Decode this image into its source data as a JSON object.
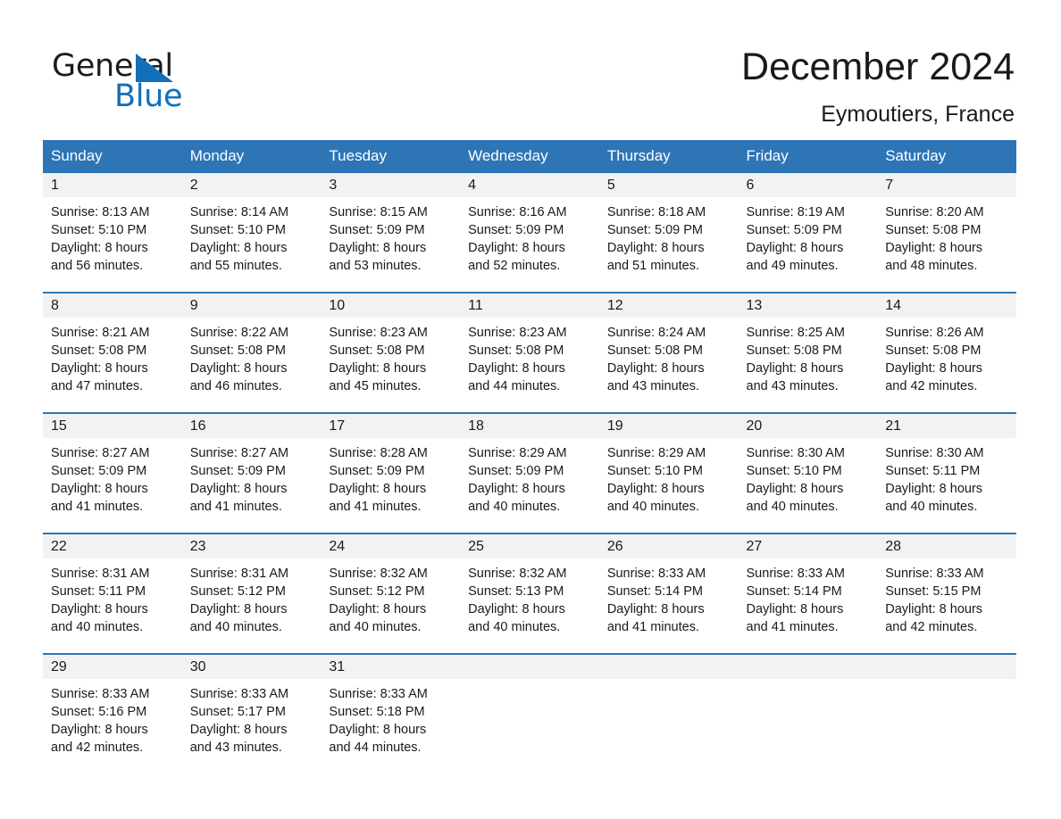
{
  "brand": {
    "name_part1": "General",
    "name_part2": "Blue",
    "triangle_color": "#1270ba",
    "logo_icon": "triangle-icon"
  },
  "header": {
    "title": "December 2024",
    "subtitle": "Eymoutiers, France"
  },
  "colors": {
    "header_blue": "#2e75b6",
    "daynum_gray": "#f2f2f2",
    "text": "#1a1a1a",
    "brand_blue": "#1270ba"
  },
  "calendar": {
    "weekday_headers": [
      "Sunday",
      "Monday",
      "Tuesday",
      "Wednesday",
      "Thursday",
      "Friday",
      "Saturday"
    ],
    "weeks": [
      [
        {
          "day": "1",
          "sunrise": "Sunrise: 8:13 AM",
          "sunset": "Sunset: 5:10 PM",
          "daylight_line1": "Daylight: 8 hours",
          "daylight_line2": "and 56 minutes."
        },
        {
          "day": "2",
          "sunrise": "Sunrise: 8:14 AM",
          "sunset": "Sunset: 5:10 PM",
          "daylight_line1": "Daylight: 8 hours",
          "daylight_line2": "and 55 minutes."
        },
        {
          "day": "3",
          "sunrise": "Sunrise: 8:15 AM",
          "sunset": "Sunset: 5:09 PM",
          "daylight_line1": "Daylight: 8 hours",
          "daylight_line2": "and 53 minutes."
        },
        {
          "day": "4",
          "sunrise": "Sunrise: 8:16 AM",
          "sunset": "Sunset: 5:09 PM",
          "daylight_line1": "Daylight: 8 hours",
          "daylight_line2": "and 52 minutes."
        },
        {
          "day": "5",
          "sunrise": "Sunrise: 8:18 AM",
          "sunset": "Sunset: 5:09 PM",
          "daylight_line1": "Daylight: 8 hours",
          "daylight_line2": "and 51 minutes."
        },
        {
          "day": "6",
          "sunrise": "Sunrise: 8:19 AM",
          "sunset": "Sunset: 5:09 PM",
          "daylight_line1": "Daylight: 8 hours",
          "daylight_line2": "and 49 minutes."
        },
        {
          "day": "7",
          "sunrise": "Sunrise: 8:20 AM",
          "sunset": "Sunset: 5:08 PM",
          "daylight_line1": "Daylight: 8 hours",
          "daylight_line2": "and 48 minutes."
        }
      ],
      [
        {
          "day": "8",
          "sunrise": "Sunrise: 8:21 AM",
          "sunset": "Sunset: 5:08 PM",
          "daylight_line1": "Daylight: 8 hours",
          "daylight_line2": "and 47 minutes."
        },
        {
          "day": "9",
          "sunrise": "Sunrise: 8:22 AM",
          "sunset": "Sunset: 5:08 PM",
          "daylight_line1": "Daylight: 8 hours",
          "daylight_line2": "and 46 minutes."
        },
        {
          "day": "10",
          "sunrise": "Sunrise: 8:23 AM",
          "sunset": "Sunset: 5:08 PM",
          "daylight_line1": "Daylight: 8 hours",
          "daylight_line2": "and 45 minutes."
        },
        {
          "day": "11",
          "sunrise": "Sunrise: 8:23 AM",
          "sunset": "Sunset: 5:08 PM",
          "daylight_line1": "Daylight: 8 hours",
          "daylight_line2": "and 44 minutes."
        },
        {
          "day": "12",
          "sunrise": "Sunrise: 8:24 AM",
          "sunset": "Sunset: 5:08 PM",
          "daylight_line1": "Daylight: 8 hours",
          "daylight_line2": "and 43 minutes."
        },
        {
          "day": "13",
          "sunrise": "Sunrise: 8:25 AM",
          "sunset": "Sunset: 5:08 PM",
          "daylight_line1": "Daylight: 8 hours",
          "daylight_line2": "and 43 minutes."
        },
        {
          "day": "14",
          "sunrise": "Sunrise: 8:26 AM",
          "sunset": "Sunset: 5:08 PM",
          "daylight_line1": "Daylight: 8 hours",
          "daylight_line2": "and 42 minutes."
        }
      ],
      [
        {
          "day": "15",
          "sunrise": "Sunrise: 8:27 AM",
          "sunset": "Sunset: 5:09 PM",
          "daylight_line1": "Daylight: 8 hours",
          "daylight_line2": "and 41 minutes."
        },
        {
          "day": "16",
          "sunrise": "Sunrise: 8:27 AM",
          "sunset": "Sunset: 5:09 PM",
          "daylight_line1": "Daylight: 8 hours",
          "daylight_line2": "and 41 minutes."
        },
        {
          "day": "17",
          "sunrise": "Sunrise: 8:28 AM",
          "sunset": "Sunset: 5:09 PM",
          "daylight_line1": "Daylight: 8 hours",
          "daylight_line2": "and 41 minutes."
        },
        {
          "day": "18",
          "sunrise": "Sunrise: 8:29 AM",
          "sunset": "Sunset: 5:09 PM",
          "daylight_line1": "Daylight: 8 hours",
          "daylight_line2": "and 40 minutes."
        },
        {
          "day": "19",
          "sunrise": "Sunrise: 8:29 AM",
          "sunset": "Sunset: 5:10 PM",
          "daylight_line1": "Daylight: 8 hours",
          "daylight_line2": "and 40 minutes."
        },
        {
          "day": "20",
          "sunrise": "Sunrise: 8:30 AM",
          "sunset": "Sunset: 5:10 PM",
          "daylight_line1": "Daylight: 8 hours",
          "daylight_line2": "and 40 minutes."
        },
        {
          "day": "21",
          "sunrise": "Sunrise: 8:30 AM",
          "sunset": "Sunset: 5:11 PM",
          "daylight_line1": "Daylight: 8 hours",
          "daylight_line2": "and 40 minutes."
        }
      ],
      [
        {
          "day": "22",
          "sunrise": "Sunrise: 8:31 AM",
          "sunset": "Sunset: 5:11 PM",
          "daylight_line1": "Daylight: 8 hours",
          "daylight_line2": "and 40 minutes."
        },
        {
          "day": "23",
          "sunrise": "Sunrise: 8:31 AM",
          "sunset": "Sunset: 5:12 PM",
          "daylight_line1": "Daylight: 8 hours",
          "daylight_line2": "and 40 minutes."
        },
        {
          "day": "24",
          "sunrise": "Sunrise: 8:32 AM",
          "sunset": "Sunset: 5:12 PM",
          "daylight_line1": "Daylight: 8 hours",
          "daylight_line2": "and 40 minutes."
        },
        {
          "day": "25",
          "sunrise": "Sunrise: 8:32 AM",
          "sunset": "Sunset: 5:13 PM",
          "daylight_line1": "Daylight: 8 hours",
          "daylight_line2": "and 40 minutes."
        },
        {
          "day": "26",
          "sunrise": "Sunrise: 8:33 AM",
          "sunset": "Sunset: 5:14 PM",
          "daylight_line1": "Daylight: 8 hours",
          "daylight_line2": "and 41 minutes."
        },
        {
          "day": "27",
          "sunrise": "Sunrise: 8:33 AM",
          "sunset": "Sunset: 5:14 PM",
          "daylight_line1": "Daylight: 8 hours",
          "daylight_line2": "and 41 minutes."
        },
        {
          "day": "28",
          "sunrise": "Sunrise: 8:33 AM",
          "sunset": "Sunset: 5:15 PM",
          "daylight_line1": "Daylight: 8 hours",
          "daylight_line2": "and 42 minutes."
        }
      ],
      [
        {
          "day": "29",
          "sunrise": "Sunrise: 8:33 AM",
          "sunset": "Sunset: 5:16 PM",
          "daylight_line1": "Daylight: 8 hours",
          "daylight_line2": "and 42 minutes."
        },
        {
          "day": "30",
          "sunrise": "Sunrise: 8:33 AM",
          "sunset": "Sunset: 5:17 PM",
          "daylight_line1": "Daylight: 8 hours",
          "daylight_line2": "and 43 minutes."
        },
        {
          "day": "31",
          "sunrise": "Sunrise: 8:33 AM",
          "sunset": "Sunset: 5:18 PM",
          "daylight_line1": "Daylight: 8 hours",
          "daylight_line2": "and 44 minutes."
        },
        {
          "day": "",
          "sunrise": "",
          "sunset": "",
          "daylight_line1": "",
          "daylight_line2": ""
        },
        {
          "day": "",
          "sunrise": "",
          "sunset": "",
          "daylight_line1": "",
          "daylight_line2": ""
        },
        {
          "day": "",
          "sunrise": "",
          "sunset": "",
          "daylight_line1": "",
          "daylight_line2": ""
        },
        {
          "day": "",
          "sunrise": "",
          "sunset": "",
          "daylight_line1": "",
          "daylight_line2": ""
        }
      ]
    ]
  }
}
